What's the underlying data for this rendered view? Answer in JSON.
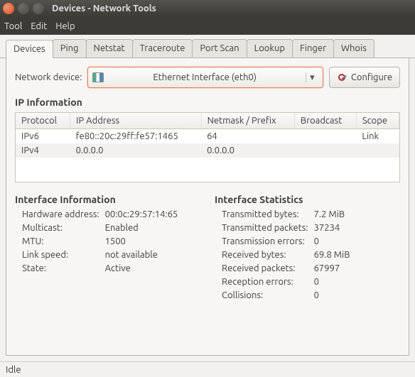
{
  "window": {
    "title": "Devices - Network Tools"
  },
  "menubar": {
    "tool": "Tool",
    "edit": "Edit",
    "help": "Help"
  },
  "tabs": {
    "devices": "Devices",
    "ping": "Ping",
    "netstat": "Netstat",
    "traceroute": "Traceroute",
    "portscan": "Port Scan",
    "lookup": "Lookup",
    "finger": "Finger",
    "whois": "Whois"
  },
  "device_row": {
    "label": "Network device:",
    "selected": "Ethernet Interface (eth0)",
    "configure": "Configure"
  },
  "ip_info": {
    "heading": "IP Information",
    "headers": {
      "protocol": "Protocol",
      "ip": "IP Address",
      "netmask": "Netmask / Prefix",
      "broadcast": "Broadcast",
      "scope": "Scope"
    },
    "rows": [
      {
        "protocol": "IPv6",
        "ip": "fe80::20c:29ff:fe57:1465",
        "netmask": "64",
        "broadcast": "",
        "scope": "Link"
      },
      {
        "protocol": "IPv4",
        "ip": "0.0.0.0",
        "netmask": "0.0.0.0",
        "broadcast": "",
        "scope": ""
      }
    ]
  },
  "iface_info": {
    "heading": "Interface Information",
    "hw_label": "Hardware address:",
    "hw_val": "00:0c:29:57:14:65",
    "mc_label": "Multicast:",
    "mc_val": "Enabled",
    "mtu_label": "MTU:",
    "mtu_val": "1500",
    "ls_label": "Link speed:",
    "ls_val": "not available",
    "st_label": "State:",
    "st_val": "Active"
  },
  "iface_stats": {
    "heading": "Interface Statistics",
    "txb_label": "Transmitted bytes:",
    "txb_val": "7.2 MiB",
    "txp_label": "Transmitted packets:",
    "txp_val": "37234",
    "txe_label": "Transmission errors:",
    "txe_val": "0",
    "rxb_label": "Received bytes:",
    "rxb_val": "69.8 MiB",
    "rxp_label": "Received packets:",
    "rxp_val": "67997",
    "rxe_label": "Reception errors:",
    "rxe_val": "0",
    "col_label": "Collisions:",
    "col_val": "0"
  },
  "status": "Idle"
}
